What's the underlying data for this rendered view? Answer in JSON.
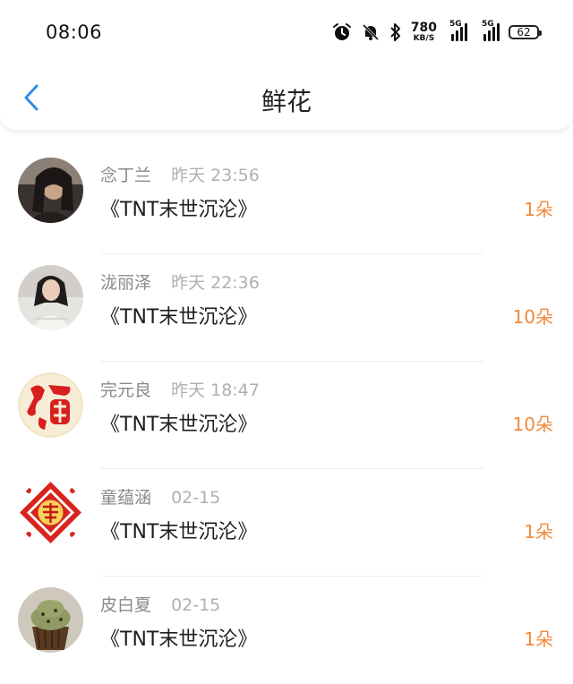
{
  "status_bar": {
    "time": "08:06",
    "net_speed_value": "780",
    "net_speed_unit": "KB/S",
    "sim1_label": "5G",
    "sim2_label": "5G",
    "battery": "62",
    "icons": [
      "alarm-icon",
      "bell-off-icon",
      "bluetooth-icon",
      "signal-icon",
      "battery-icon"
    ]
  },
  "header": {
    "title": "鲜花",
    "back_icon": "back-chevron-icon"
  },
  "colors": {
    "accent": "#f08a3c",
    "back_icon": "#2f8fe6",
    "meta_text": "#8a8a8a"
  },
  "items": [
    {
      "name": "念丁兰",
      "time": "昨天 23:56",
      "book": "《TNT末世沉沦》",
      "count": "1朵",
      "avatar": "avatar-girl-dark"
    },
    {
      "name": "泷丽泽",
      "time": "昨天 22:36",
      "book": "《TNT末世沉沦》",
      "count": "10朵",
      "avatar": "avatar-girl-white"
    },
    {
      "name": "完元良",
      "time": "昨天 18:47",
      "book": "《TNT末世沉沦》",
      "count": "10朵",
      "avatar": "avatar-fu-red"
    },
    {
      "name": "童蕴涵",
      "time": "02-15",
      "book": "《TNT末世沉沦》",
      "count": "1朵",
      "avatar": "avatar-fu-papercut"
    },
    {
      "name": "皮白夏",
      "time": "02-15",
      "book": "《TNT末世沉沦》",
      "count": "1朵",
      "avatar": "avatar-cupcake"
    }
  ]
}
